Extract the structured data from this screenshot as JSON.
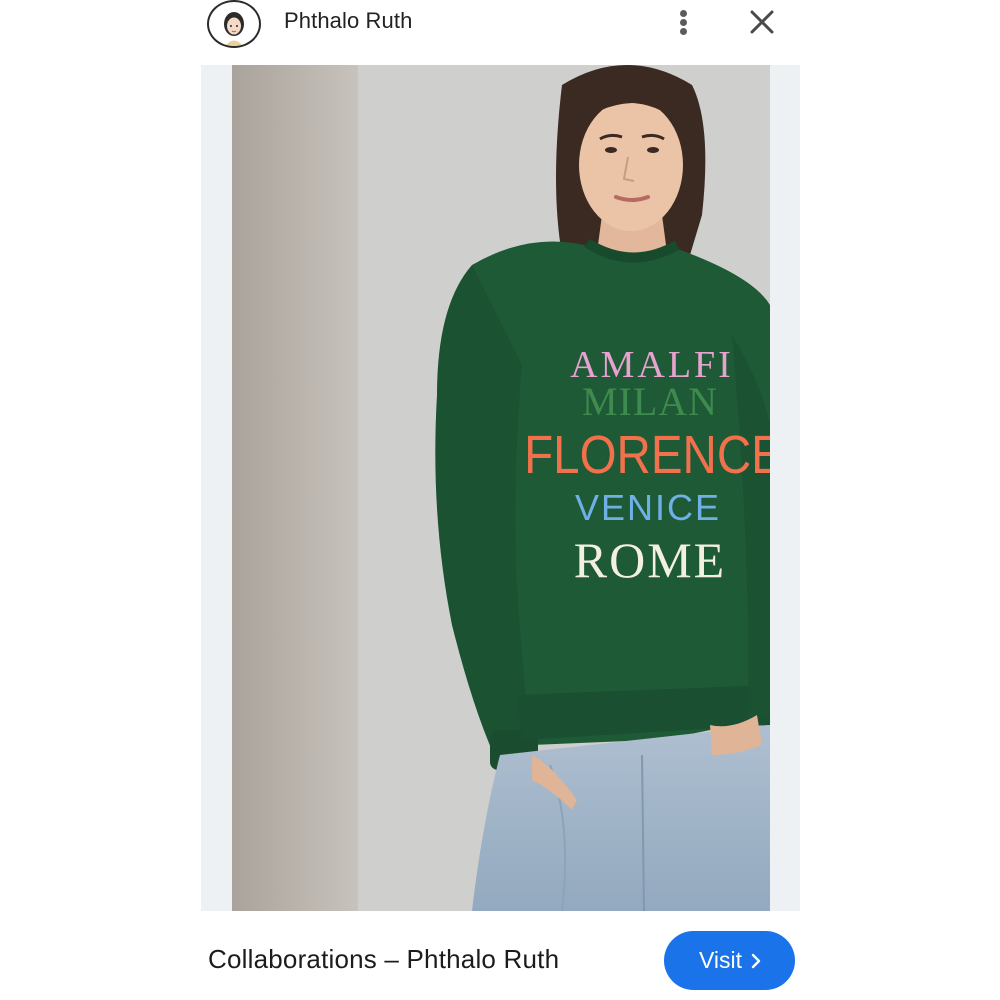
{
  "header": {
    "account_name": "Phthalo Ruth",
    "avatar_icon": "illustrated-woman-avatar",
    "more_icon": "more-vertical-icon",
    "close_icon": "close-icon"
  },
  "pin": {
    "image_description_icon": "product-photo",
    "shirt_text": [
      "AMALFI",
      "MILAN",
      "FLORENCE",
      "VENICE",
      "ROME"
    ],
    "shirt_text_colors": [
      "#e7a3cf",
      "#3f8a4e",
      "#f0714b",
      "#6fb0e6",
      "#f3efe2"
    ]
  },
  "footer": {
    "caption": "Collaborations – Phthalo Ruth",
    "visit_label": "Visit",
    "visit_icon": "chevron-right-icon"
  },
  "colors": {
    "accent": "#1a73e8",
    "sweatshirt": "#1f5a37",
    "frame_bg": "#edf1f3"
  }
}
